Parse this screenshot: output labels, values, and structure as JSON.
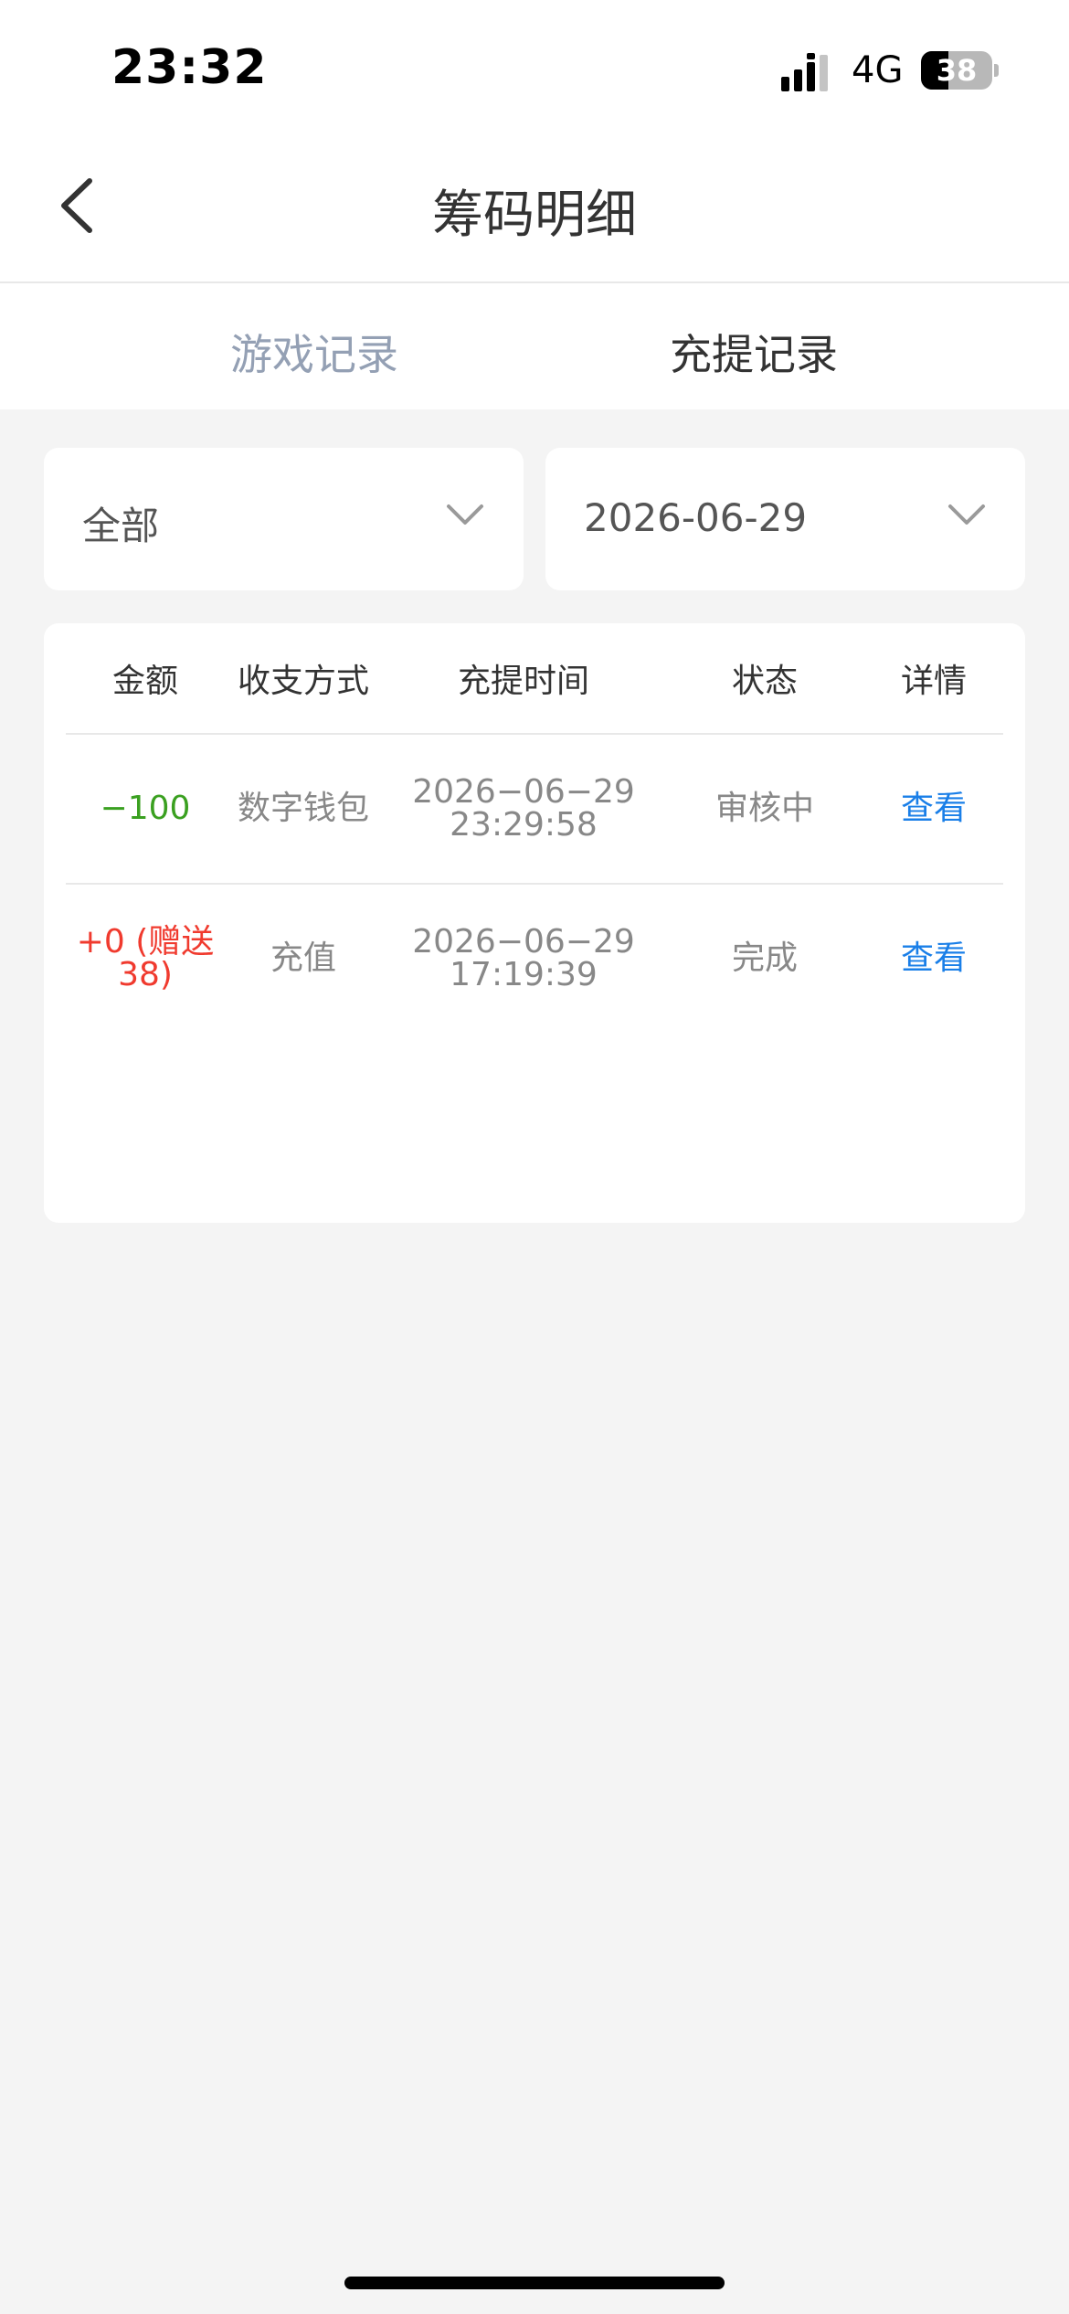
{
  "status_bar": {
    "time": "23:32",
    "network": "4G",
    "battery_level": "38",
    "battery_fraction": 0.38
  },
  "header": {
    "title": "筹码明细",
    "back_icon": "chevron-left-icon"
  },
  "tabs": [
    {
      "label": "游戏记录",
      "active": false
    },
    {
      "label": "充提记录",
      "active": true
    }
  ],
  "filters": {
    "type": "全部",
    "date": "2026-06-29",
    "dropdown_icon": "chevron-down-icon"
  },
  "table": {
    "headers": [
      "金额",
      "收支方式",
      "充提时间",
      "状态",
      "详情"
    ],
    "rows": [
      {
        "amount": "−100",
        "method": "数字钱包",
        "date": "2026−06−29",
        "time": "23:29:58",
        "status": "审核中",
        "detail": "查看"
      },
      {
        "amount": "+0 (赠送 38)",
        "method": "充值",
        "date": "2026−06−29",
        "time": "17:19:39",
        "status": "完成",
        "detail": "查看"
      }
    ]
  },
  "colors": {
    "negative_amount": "#3aa020",
    "positive_amount": "#f03a2e",
    "link": "#1a7fe8",
    "inactive_tab": "#94a0b4",
    "background": "#f4f4f4"
  }
}
